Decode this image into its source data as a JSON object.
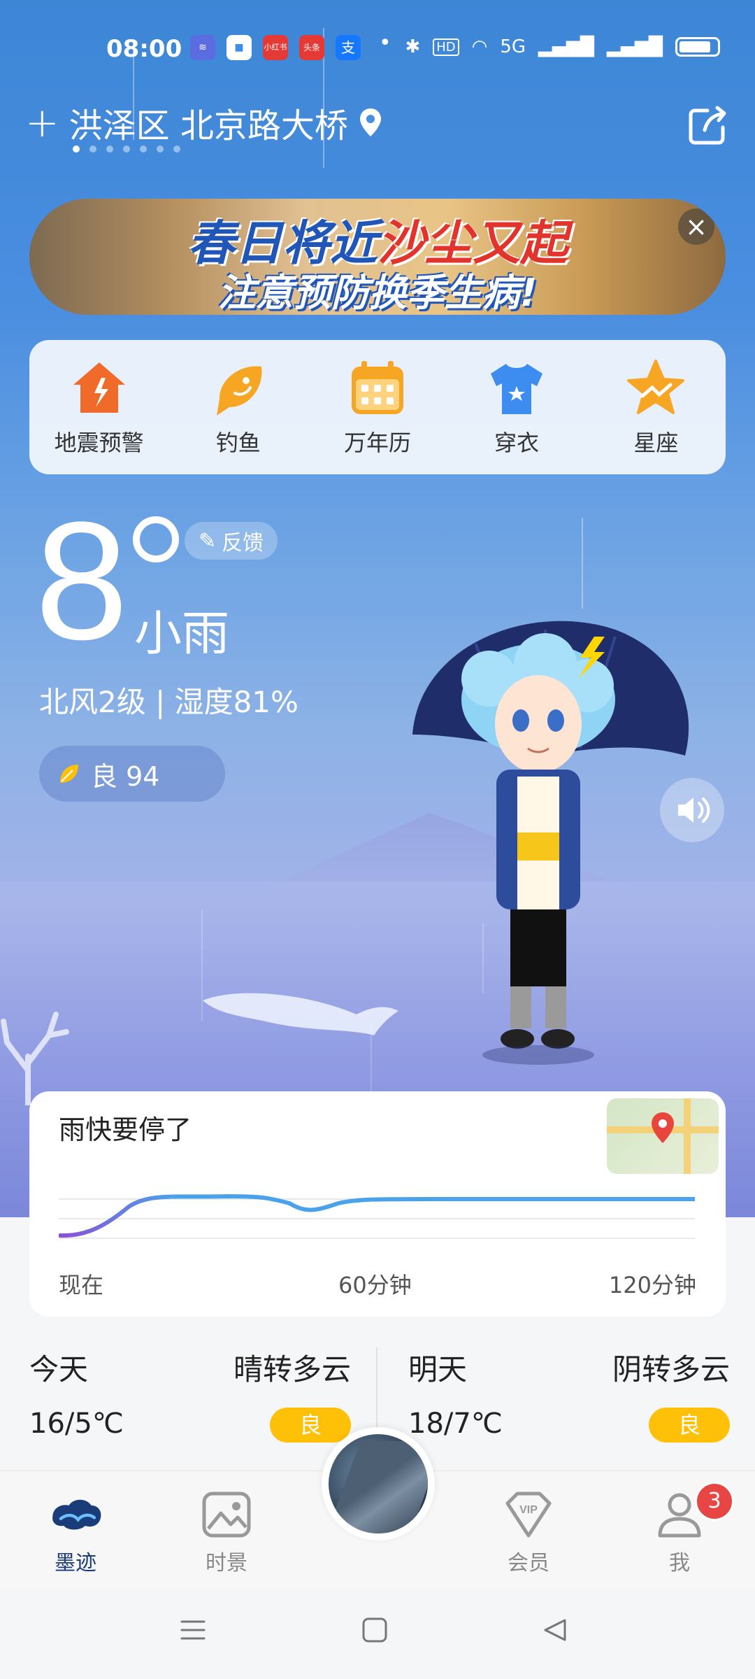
{
  "status_bar": {
    "time": "08:00",
    "app_icons": [
      "signal-app",
      "blue-app",
      "小红书",
      "头条",
      "支"
    ],
    "network": "5G"
  },
  "location": {
    "name": "洪泽区 北京路大桥",
    "page_count": 7,
    "active_index": 0
  },
  "banner": {
    "line1_a": "春日将近",
    "line1_b": "沙尘又起",
    "line2": "注意预防换季生病!"
  },
  "tools": [
    {
      "label": "地震预警",
      "icon": "earthquake-icon",
      "color": "#f06a2a"
    },
    {
      "label": "钓鱼",
      "icon": "fish-icon",
      "color": "#f6a623"
    },
    {
      "label": "万年历",
      "icon": "calendar-icon",
      "color": "#f6a623"
    },
    {
      "label": "穿衣",
      "icon": "tshirt-icon",
      "color": "#3d8df0"
    },
    {
      "label": "星座",
      "icon": "star-icon",
      "color": "#f6a623"
    }
  ],
  "current": {
    "temp": "8",
    "condition": "小雨",
    "feedback_label": "反馈",
    "wind_humidity": "北风2级 | 湿度81%",
    "aqi_label": "良 94"
  },
  "rain_card": {
    "title": "雨快要停了",
    "axis": [
      "现在",
      "60分钟",
      "120分钟"
    ]
  },
  "forecast": [
    {
      "day": "今天",
      "desc": "晴转多云",
      "range": "16/5℃",
      "aqi": "良"
    },
    {
      "day": "明天",
      "desc": "阴转多云",
      "range": "18/7℃",
      "aqi": "良"
    }
  ],
  "bottom_nav": {
    "items": [
      {
        "label": "墨迹",
        "icon": "moji-logo-icon",
        "active": true
      },
      {
        "label": "时景",
        "icon": "picture-icon",
        "active": false
      },
      {
        "label": "会员",
        "icon": "vip-icon",
        "active": false
      },
      {
        "label": "我",
        "icon": "user-icon",
        "active": false
      }
    ],
    "badge": "3"
  },
  "colors": {
    "accent": "#3d86d6",
    "aqi_good": "#ffc107",
    "badge": "#e84545"
  }
}
